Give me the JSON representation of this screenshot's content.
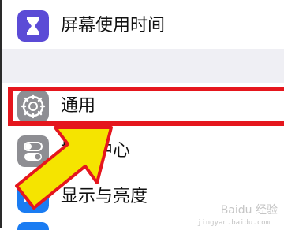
{
  "rows": [
    {
      "label": "屏幕使用时间",
      "icon": "hourglass-icon",
      "icon_color": "#5b4bd6"
    },
    {
      "label": "通用",
      "icon": "gear-icon",
      "icon_color": "#8e8e93"
    },
    {
      "label": "控制中心",
      "icon": "toggle-switches-icon",
      "icon_color": "#8e8e93"
    },
    {
      "label": "显示与亮度",
      "icon": "display-aa-icon",
      "icon_color": "#1a7cf2"
    }
  ],
  "annotation": {
    "highlight_color": "#e5161d",
    "arrow_color": "#f5e400",
    "arrow_outline_color": "#e5161d"
  },
  "watermark": {
    "text": "Baidu 经验",
    "sub": "jingyan.baidu.com"
  }
}
